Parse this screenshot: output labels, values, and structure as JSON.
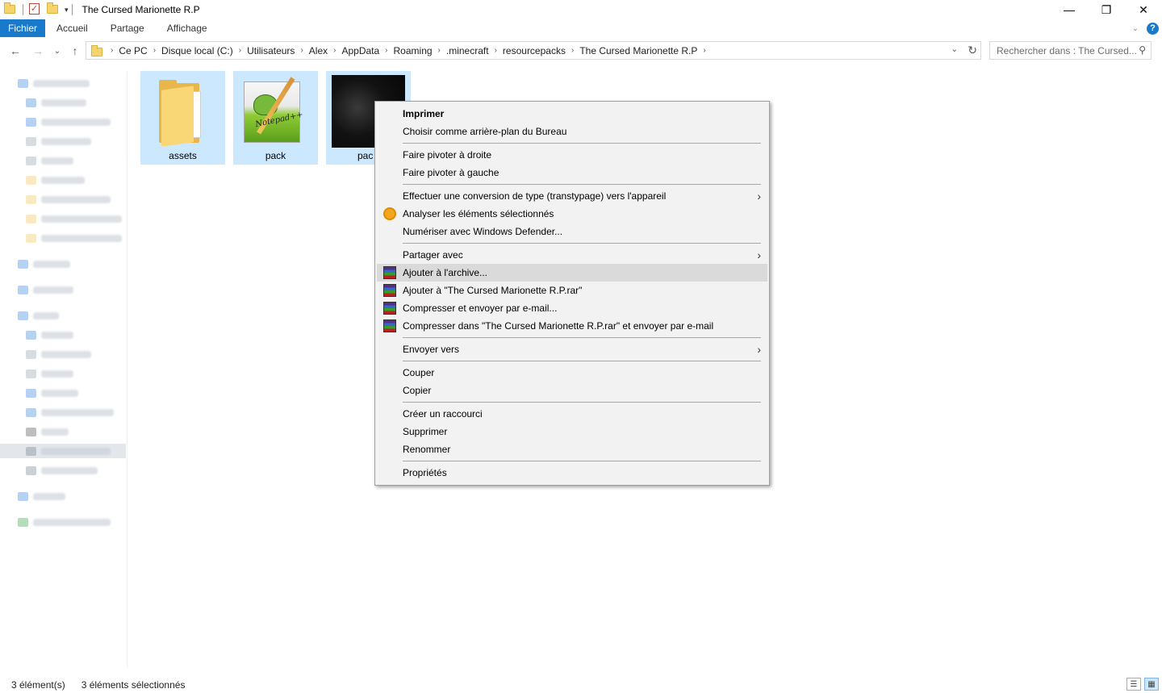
{
  "window": {
    "title": "The Cursed Marionette R.P",
    "minimize_glyph": "—",
    "maximize_glyph": "❐",
    "close_glyph": "✕"
  },
  "quick_access_toolbar": {
    "dropdown_glyph": "▾"
  },
  "ribbon": {
    "tabs": [
      {
        "label": "Fichier"
      },
      {
        "label": "Accueil"
      },
      {
        "label": "Partage"
      },
      {
        "label": "Affichage"
      }
    ],
    "expand_glyph": "⌄",
    "help_glyph": "?"
  },
  "navigation": {
    "back_glyph": "←",
    "forward_glyph": "→",
    "recent_glyph": "⌄",
    "up_glyph": "↑"
  },
  "address_bar": {
    "separator": "›",
    "crumbs": [
      "Ce PC",
      "Disque local (C:)",
      "Utilisateurs",
      "Alex",
      "AppData",
      "Roaming",
      ".minecraft",
      "resourcepacks",
      "The Cursed Marionette R.P"
    ],
    "dropdown_glyph": "⌄",
    "refresh_glyph": "↻"
  },
  "search": {
    "placeholder": "Rechercher dans : The Cursed...",
    "icon_glyph": "⚲"
  },
  "files": [
    {
      "name": "assets",
      "type": "folder"
    },
    {
      "name": "pack",
      "type": "notepad-document"
    },
    {
      "name": "pac",
      "type": "image"
    }
  ],
  "notepad_logo_text": "Notepad++",
  "context_menu": {
    "items": [
      {
        "label": "Imprimer",
        "bold": true
      },
      {
        "label": "Choisir comme arrière-plan du Bureau"
      },
      {
        "label": "Faire pivoter à droite"
      },
      {
        "label": "Faire pivoter à gauche"
      },
      {
        "label": "Effectuer une conversion de type (transtypage) vers l'appareil",
        "submenu": true
      },
      {
        "label": "Analyser les éléments sélectionnés",
        "icon": "scan-icon"
      },
      {
        "label": "Numériser avec Windows Defender..."
      },
      {
        "label": "Partager avec",
        "submenu": true
      },
      {
        "label": "Ajouter à l'archive...",
        "icon": "winrar-icon",
        "highlighted": true
      },
      {
        "label": "Ajouter à \"The Cursed Marionette R.P.rar\"",
        "icon": "winrar-icon"
      },
      {
        "label": "Compresser et envoyer par e-mail...",
        "icon": "winrar-icon"
      },
      {
        "label": "Compresser dans \"The Cursed Marionette R.P.rar\" et envoyer par e-mail",
        "icon": "winrar-icon"
      },
      {
        "label": "Envoyer vers",
        "submenu": true
      },
      {
        "label": "Couper"
      },
      {
        "label": "Copier"
      },
      {
        "label": "Créer un raccourci"
      },
      {
        "label": "Supprimer"
      },
      {
        "label": "Renommer"
      },
      {
        "label": "Propriétés"
      }
    ],
    "submenu_glyph": "›"
  },
  "status_bar": {
    "item_count": "3 élément(s)",
    "selected_count": "3 éléments sélectionnés",
    "details_view_glyph": "☰",
    "tiles_view_glyph": "▦"
  },
  "colors": {
    "accent": "#1979ca",
    "selection": "#cce8ff",
    "menu_bg": "#f2f2f2",
    "menu_hover": "#dadada"
  }
}
